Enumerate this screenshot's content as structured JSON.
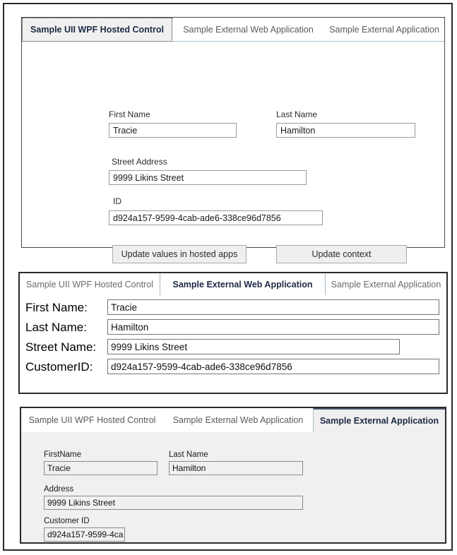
{
  "panels": [
    {
      "name": "wpf-hosted-control-panel",
      "tabs": [
        {
          "label": "Sample UII WPF Hosted Control",
          "active": true
        },
        {
          "label": "Sample External Web Application",
          "active": false
        },
        {
          "label": "Sample External Application",
          "active": false
        }
      ],
      "fields": {
        "first_name_label": "First Name",
        "first_name_value": "Tracie",
        "last_name_label": "Last Name",
        "last_name_value": "Hamilton",
        "street_address_label": "Street Address",
        "street_address_value": "9999 Likins Street",
        "id_label": "ID",
        "id_value": "d924a157-9599-4cab-ade6-338ce96d7856"
      },
      "buttons": {
        "update_values": "Update values in hosted apps",
        "update_context": "Update context"
      }
    },
    {
      "name": "external-web-application-panel",
      "tabs": [
        {
          "label": "Sample UII WPF Hosted Control",
          "active": false
        },
        {
          "label": "Sample External Web Application",
          "active": true
        },
        {
          "label": "Sample External Application",
          "active": false
        }
      ],
      "fields": {
        "first_name_label": "First Name:",
        "first_name_value": "Tracie",
        "last_name_label": "Last Name:",
        "last_name_value": "Hamilton",
        "street_name_label": "Street Name:",
        "street_name_value": "9999 Likins Street",
        "customer_id_label": "CustomerID:",
        "customer_id_value": "d924a157-9599-4cab-ade6-338ce96d7856"
      }
    },
    {
      "name": "external-application-panel",
      "tabs": [
        {
          "label": "Sample UII WPF Hosted Control",
          "active": false
        },
        {
          "label": "Sample External Web Application",
          "active": false
        },
        {
          "label": "Sample External Application",
          "active": true
        }
      ],
      "fields": {
        "first_name_label": "FirstName",
        "first_name_value": "Tracie",
        "last_name_label": "Last Name",
        "last_name_value": "Hamilton",
        "address_label": "Address",
        "address_value": "9999 Likins Street",
        "customer_id_label": "Customer ID",
        "customer_id_value": "d924a157-9599-4ca"
      }
    }
  ],
  "colors": {
    "frame_border": "#2b2b2b",
    "active_tab_text": "#1c2a44",
    "inactive_tab_text": "#5a5a5a",
    "tab_strip_underline": "#a7bcca",
    "panel3_background": "#f0f0f0",
    "button_background": "#efefef"
  }
}
